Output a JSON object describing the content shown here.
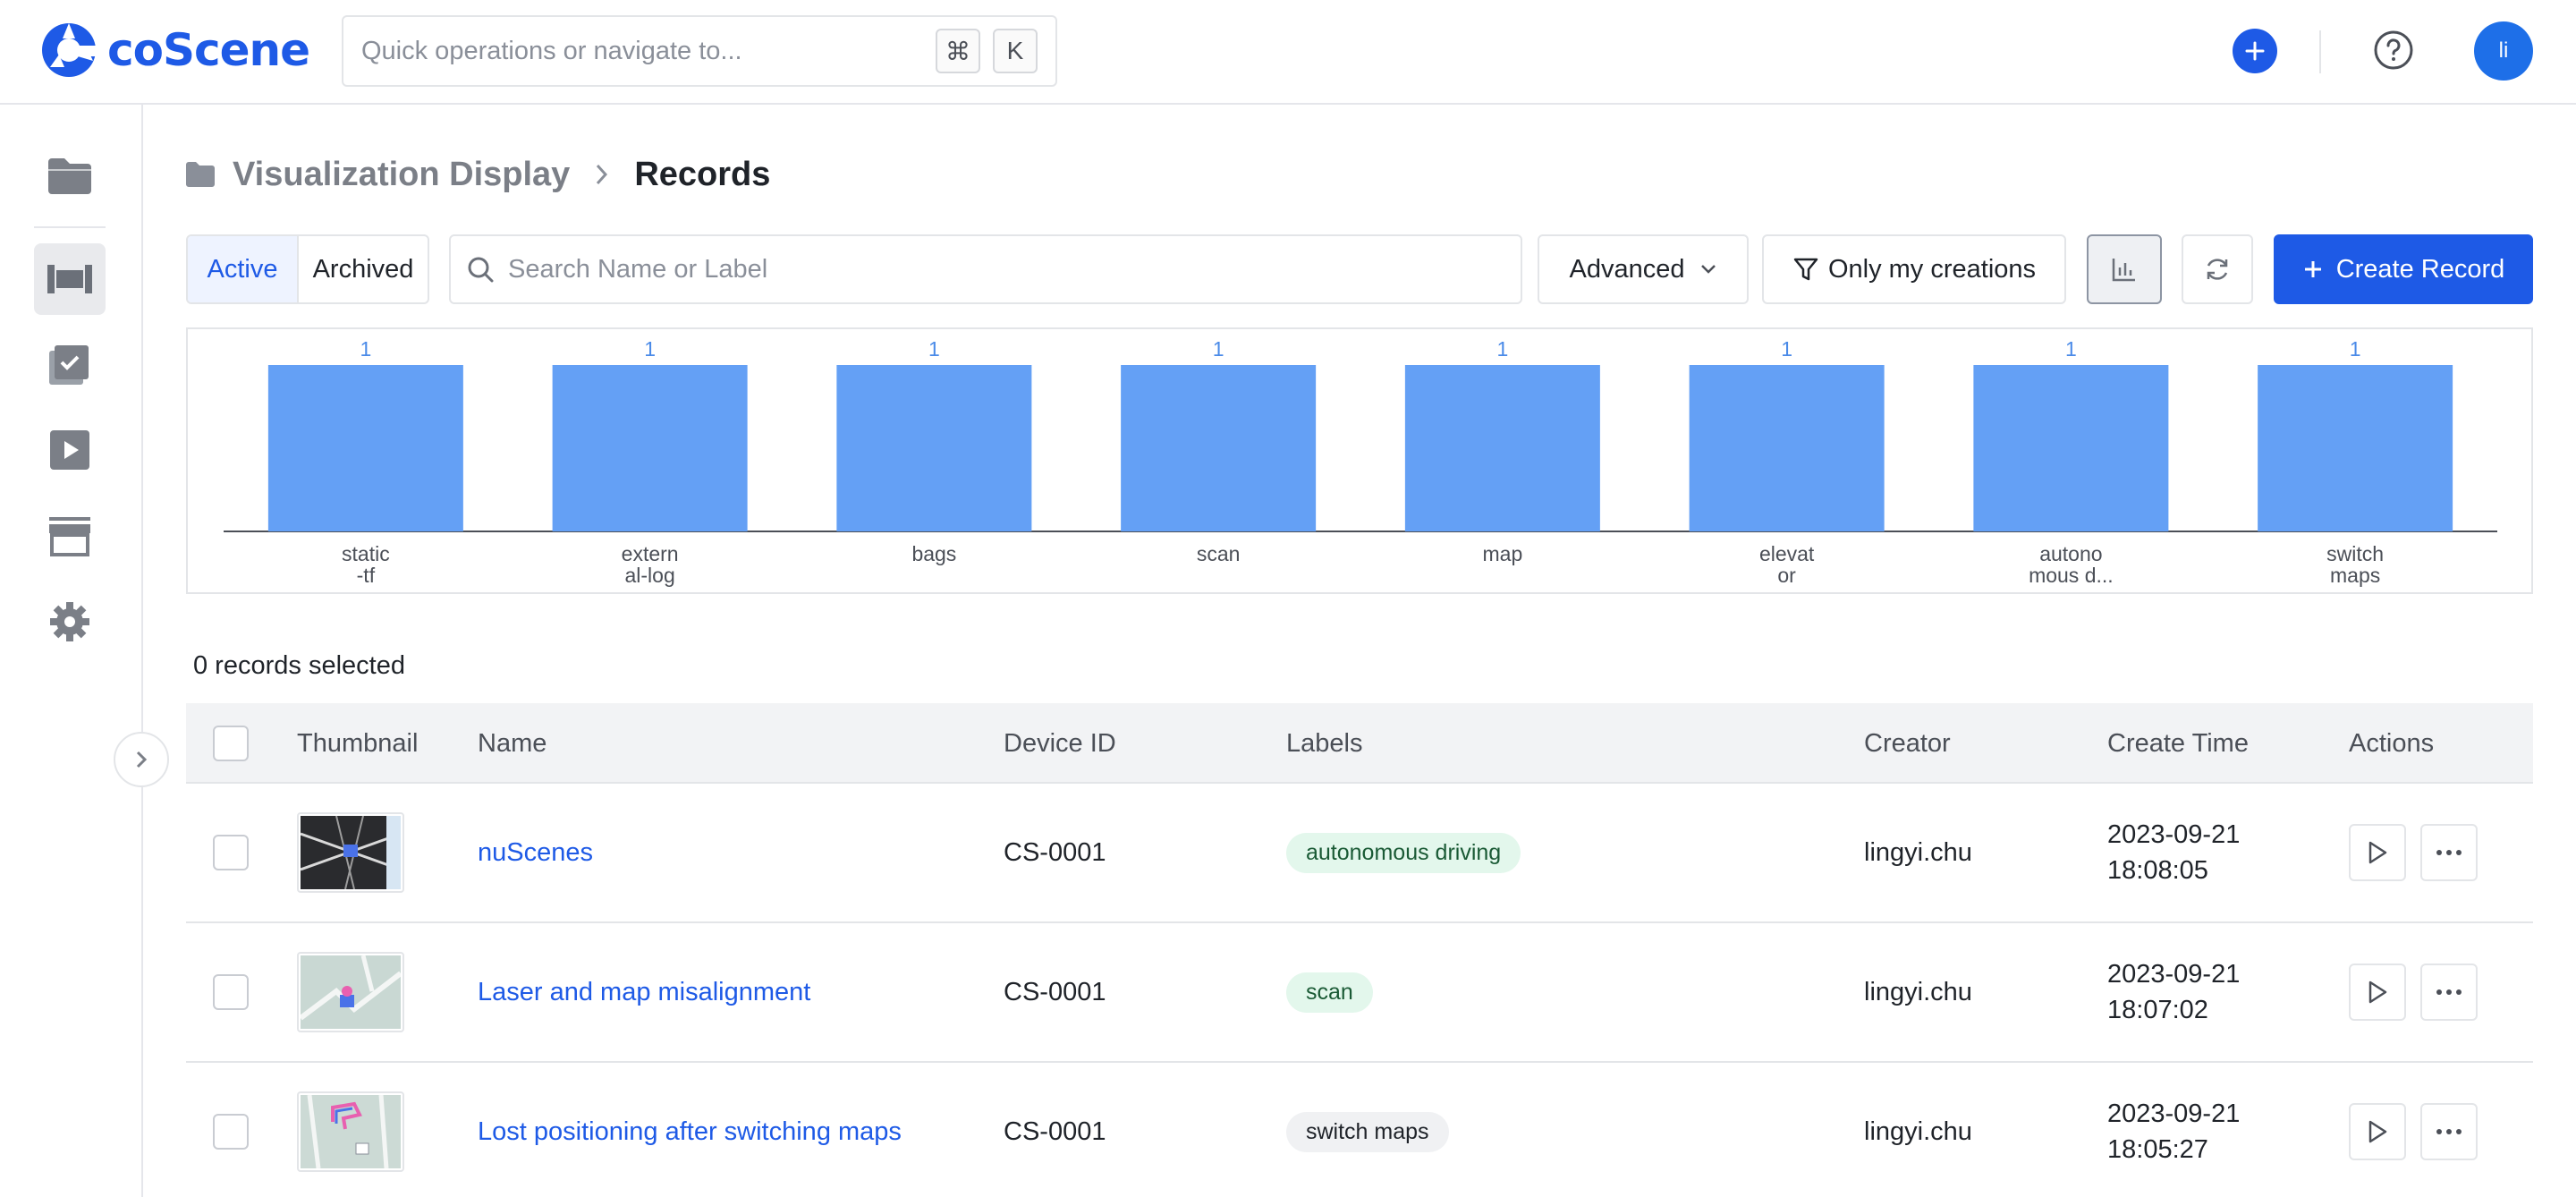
{
  "app": {
    "brand": "coScene",
    "quick_nav_placeholder": "Quick operations or navigate to...",
    "shortcut_keys": [
      "⌘",
      "K"
    ],
    "user_initials": "li",
    "accent": "#1e5ae6"
  },
  "sidebar": {
    "items": [
      {
        "icon": "folder-icon",
        "active": false
      },
      {
        "icon": "records-icon",
        "active": true
      },
      {
        "icon": "tasks-icon",
        "active": false
      },
      {
        "icon": "play-icon",
        "active": false
      },
      {
        "icon": "archive-icon",
        "active": false
      },
      {
        "icon": "gear-icon",
        "active": false
      }
    ]
  },
  "breadcrumb": {
    "parent": "Visualization Display",
    "current": "Records"
  },
  "toolbar": {
    "tab_active": "Active",
    "tab_archived": "Archived",
    "search_placeholder": "Search Name or Label",
    "advanced_label": "Advanced",
    "only_mine_label": "Only my creations",
    "create_label": "Create Record"
  },
  "chart_data": {
    "type": "bar",
    "categories": [
      "static-tf",
      "external-log",
      "bags",
      "scan",
      "map",
      "elevator",
      "autonomous driving",
      "switch maps"
    ],
    "tick_labels": [
      [
        "static",
        "-tf"
      ],
      [
        "extern",
        "al-log"
      ],
      [
        "bags"
      ],
      [
        "scan"
      ],
      [
        "map"
      ],
      [
        "elevat",
        "or"
      ],
      [
        "autono",
        "mous d..."
      ],
      [
        "switch",
        "maps"
      ]
    ],
    "values": [
      1,
      1,
      1,
      1,
      1,
      1,
      1,
      1
    ],
    "ylim": [
      0,
      1
    ],
    "grid": false,
    "bar_color": "#64a0f5",
    "label_color": "#4a8ae8"
  },
  "selection": {
    "text": "0 records selected"
  },
  "table": {
    "headers": {
      "thumbnail": "Thumbnail",
      "name": "Name",
      "device": "Device ID",
      "labels": "Labels",
      "creator": "Creator",
      "time": "Create Time",
      "actions": "Actions"
    },
    "rows": [
      {
        "name": "nuScenes",
        "device": "CS-0001",
        "label": "autonomous driving",
        "label_style": "green",
        "creator": "lingyi.chu",
        "date": "2023-09-21",
        "clock": "18:08:05",
        "thumb": "dark"
      },
      {
        "name": "Laser and map misalignment",
        "device": "CS-0001",
        "label": "scan",
        "label_style": "green",
        "creator": "lingyi.chu",
        "date": "2023-09-21",
        "clock": "18:07:02",
        "thumb": "map"
      },
      {
        "name": "Lost positioning after switching maps",
        "device": "CS-0001",
        "label": "switch maps",
        "label_style": "gray",
        "creator": "lingyi.chu",
        "date": "2023-09-21",
        "clock": "18:05:27",
        "thumb": "map2"
      }
    ]
  }
}
